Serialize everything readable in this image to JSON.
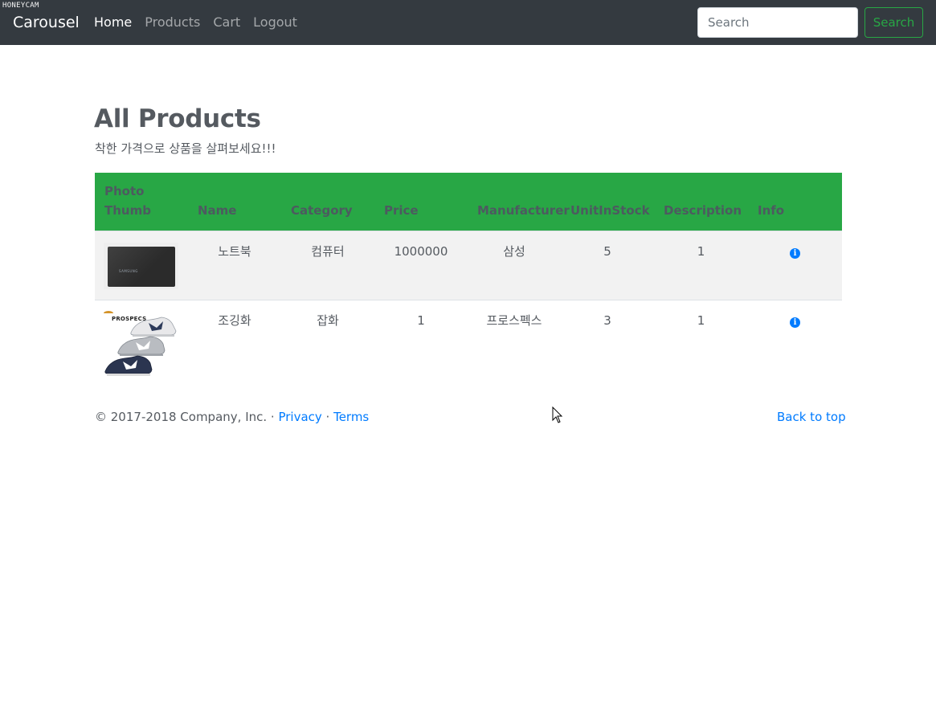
{
  "watermark": "HONEYCAM",
  "navbar": {
    "brand": "Carousel",
    "links": [
      {
        "label": "Home",
        "active": true
      },
      {
        "label": "Products",
        "active": false
      },
      {
        "label": "Cart",
        "active": false
      },
      {
        "label": "Logout",
        "active": false
      }
    ],
    "search": {
      "placeholder": "Search",
      "value": "",
      "button_label": "Search"
    }
  },
  "page": {
    "title": "All Products",
    "subtitle": "착한 가격으로 상품을 살펴보세요!!!"
  },
  "table": {
    "headers": [
      "Photo Thumb",
      "Name",
      "Category",
      "Price",
      "Manufacturer",
      "UnitInStock",
      "Description",
      "Info"
    ],
    "rows": [
      {
        "thumb": "laptop-image",
        "thumb_brand": "SAMSUNG",
        "name": "노트북",
        "category": "컴퓨터",
        "price": "1000000",
        "manufacturer": "삼성",
        "stock": "5",
        "description": "1",
        "info_icon": "info-circle-icon"
      },
      {
        "thumb": "sneakers-image",
        "thumb_brand": "PROSPECS",
        "name": "조깅화",
        "category": "잡화",
        "price": "1",
        "manufacturer": "프로스펙스",
        "stock": "3",
        "description": "1",
        "info_icon": "info-circle-icon"
      }
    ]
  },
  "footer": {
    "copyright": "© 2017-2018 Company, Inc. · ",
    "privacy": "Privacy",
    "separator": " · ",
    "terms": "Terms",
    "back_to_top": "Back to top"
  },
  "colors": {
    "navbar_bg": "#343a40",
    "table_header_bg": "#28a745",
    "link": "#007bff",
    "search_button": "#28a745"
  }
}
